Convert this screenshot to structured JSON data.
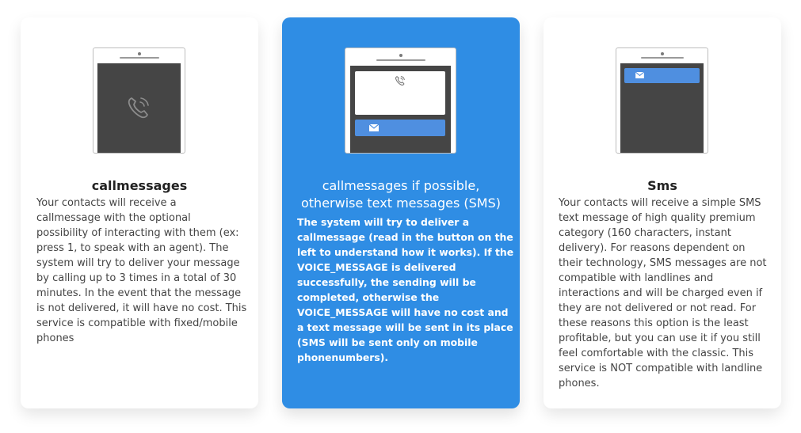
{
  "colors": {
    "accent": "#2f8de4",
    "phone_screen": "#454545",
    "sms_bar": "#4f8fe0"
  },
  "icons": {
    "card1_phone": "phone-call-icon",
    "card2_phone": "phone-call-icon",
    "card2_message": "envelope-icon",
    "card3_message": "envelope-icon"
  },
  "cards": [
    {
      "title": "callmessages",
      "description": "Your contacts will receive a\ncallmessage with the optional\npossibility of interacting with them (ex:\npress 1, to speak with an agent). The\nsystem will try to deliver your message\nby calling up to 3 times in a total of 30\nminutes. In the event that the message\nis not delivered, it will have no cost. This\nservice is compatible with fixed/mobile\nphones"
    },
    {
      "title": "callmessages if possible,\notherwise text messages (SMS)",
      "description": "The system will try to deliver a\ncallmessage (read in the button on the\nleft to understand how it works). If the\nVOICE_MESSAGE is delivered\nsuccessfully, the sending will be\ncompleted, otherwise the\nVOICE_MESSAGE will have no cost and\na text message will be sent in its place\n(SMS will be sent only on mobile\nphonenumbers)."
    },
    {
      "title": "Sms",
      "description": "Your contacts will receive a simple SMS\ntext message of high quality premium\ncategory (160 characters, instant\ndelivery). For reasons dependent on\ntheir technology, SMS messages are not\ncompatible with landlines and\ninteractions and will be charged even if\nthey are not delivered or not read. For\nthese reasons this option is the least\nprofitable, but you can use it if you still\nfeel comfortable with the classic. This\nservice is NOT compatible with landline\nphones."
    }
  ]
}
